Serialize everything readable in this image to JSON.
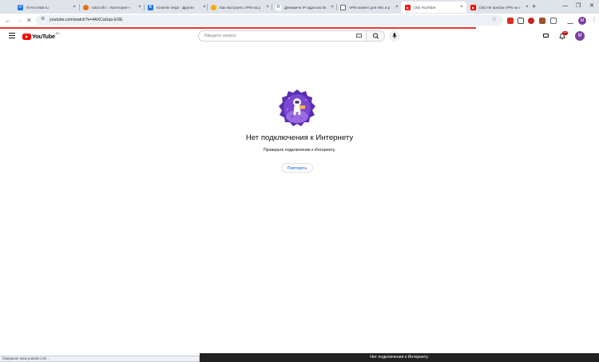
{
  "browser": {
    "tabs": [
      {
        "title": "Почта Mail.ru",
        "color": "#1a73e8",
        "glyph": "✉"
      },
      {
        "title": "rutor.info :: Категория »",
        "color": "#e8710a",
        "glyph": "●"
      },
      {
        "title": "Kinemix Vega - Другие",
        "color": "#1976d2",
        "glyph": "K"
      },
      {
        "title": "Как настроить VPN на р",
        "color": "#f9ab00",
        "glyph": "●"
      },
      {
        "title": "Динамичн IP адресов бе",
        "color": "#3a8ee6",
        "glyph": "R"
      },
      {
        "title": "VPN клиент для Win и р",
        "color": "#5f6368",
        "glyph": "▢"
      },
      {
        "title": "(34) YouTube",
        "color": "#ff0000",
        "glyph": "▶",
        "active": true
      },
      {
        "title": "(34) Не пробок VPN на т",
        "color": "#ff0000",
        "glyph": "▶"
      }
    ],
    "new_tab_glyph": "+",
    "window_controls": {
      "minimize": "—",
      "restore": "❐",
      "close": "✕"
    },
    "address": "youtube.com/watch?v=4AXCaGqo-ESE",
    "profile_initial": "M",
    "extension_colors": [
      "#d93025",
      "#444444",
      "#c5221f",
      "#a0522d",
      "#5f6368"
    ]
  },
  "youtube": {
    "logo_text": "YouTube",
    "country_code": "RU",
    "search_placeholder": "Введите запрос",
    "notification_count": "9+",
    "avatar_initial": "M"
  },
  "offline": {
    "title": "Нет подключения к Интернету",
    "subtitle": "Проверьте подключение к Интернету.",
    "retry_label": "Повторить"
  },
  "status_text": "Ожидание www.youtube.com...",
  "toast_text": "Нет подключения к Интернету."
}
